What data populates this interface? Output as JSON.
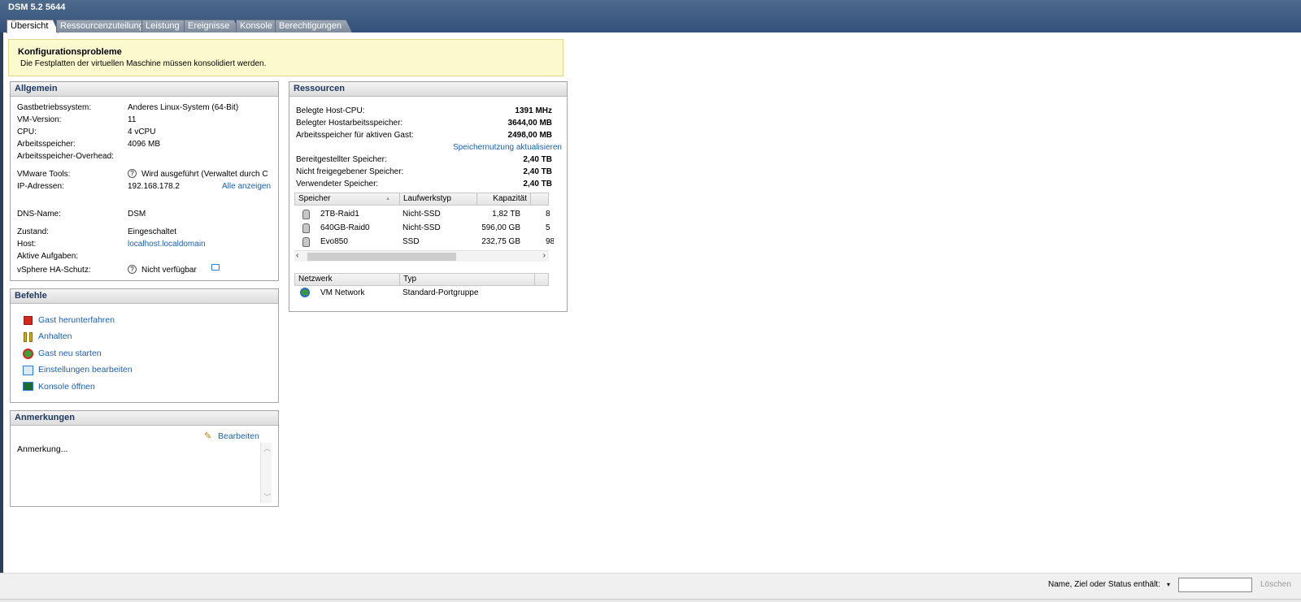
{
  "window": {
    "title": "DSM 5.2 5644"
  },
  "tabs": [
    {
      "label": "Übersicht"
    },
    {
      "label": "Ressourcenzuteilung"
    },
    {
      "label": "Leistung"
    },
    {
      "label": "Ereignisse"
    },
    {
      "label": "Konsole"
    },
    {
      "label": "Berechtigungen"
    }
  ],
  "alert": {
    "title": "Konfigurationsprobleme",
    "text": "Die Festplatten der virtuellen Maschine müssen konsolidiert werden."
  },
  "general": {
    "title": "Allgemein",
    "rows": [
      {
        "label": "Gastbetriebssystem:",
        "value": "Anderes Linux-System (64-Bit)"
      },
      {
        "label": "VM-Version:",
        "value": "11"
      },
      {
        "label": "CPU:",
        "value": "4 vCPU"
      },
      {
        "label": "Arbeitsspeicher:",
        "value": "4096 MB"
      },
      {
        "label": "Arbeitsspeicher-Overhead:",
        "value": ""
      },
      {
        "label": "VMware Tools:",
        "value": "Wird ausgeführt (Verwaltet durch C"
      },
      {
        "label": "IP-Adressen:",
        "value": "192.168.178.2"
      },
      {
        "label": "DNS-Name:",
        "value": "DSM"
      },
      {
        "label": "Zustand:",
        "value": "Eingeschaltet"
      },
      {
        "label": "Host:",
        "value": "localhost.localdomain"
      },
      {
        "label": "Aktive Aufgaben:",
        "value": ""
      },
      {
        "label": "vSphere HA-Schutz:",
        "value": "Nicht verfügbar"
      }
    ],
    "show_all_link": "Alle anzeigen"
  },
  "commands": {
    "title": "Befehle",
    "items": [
      {
        "label": "Gast herunterfahren",
        "icon": "stop-icon",
        "color": "#d9261c"
      },
      {
        "label": "Anhalten",
        "icon": "pause-icon",
        "color": "#e0a800"
      },
      {
        "label": "Gast neu starten",
        "icon": "restart-icon",
        "color": "#d9261c"
      },
      {
        "label": "Einstellungen bearbeiten",
        "icon": "edit-settings-icon",
        "color": "#2a7fd6"
      },
      {
        "label": "Konsole öffnen",
        "icon": "console-icon",
        "color": "#2a7fd6"
      }
    ]
  },
  "notes": {
    "title": "Anmerkungen",
    "edit_label": "Bearbeiten",
    "text": "Anmerkung..."
  },
  "resources": {
    "title": "Ressourcen",
    "rows1": [
      {
        "label": "Belegte Host-CPU:",
        "value": "1391 MHz"
      },
      {
        "label": "Belegter Hostarbeitsspeicher:",
        "value": "3644,00 MB"
      },
      {
        "label": "Arbeitsspeicher für aktiven Gast:",
        "value": "2498,00 MB"
      }
    ],
    "refresh_link": "Speichernutzung aktualisieren",
    "rows2": [
      {
        "label": "Bereitgestellter Speicher:",
        "value": "2,40 TB"
      },
      {
        "label": "Nicht freigegebener Speicher:",
        "value": "2,40 TB"
      },
      {
        "label": "Verwendeter Speicher:",
        "value": "2,40 TB"
      }
    ],
    "storage_headers": [
      "Speicher",
      "Laufwerkstyp",
      "Kapazität"
    ],
    "storage": [
      {
        "name": "2TB-Raid1",
        "type": "Nicht-SSD",
        "capacity": "1,82 TB",
        "extra": "8"
      },
      {
        "name": "640GB-Raid0",
        "type": "Nicht-SSD",
        "capacity": "596,00 GB",
        "extra": "5"
      },
      {
        "name": "Evo850",
        "type": "SSD",
        "capacity": "232,75 GB",
        "extra": "98"
      }
    ],
    "network_headers": [
      "Netzwerk",
      "Typ"
    ],
    "network": [
      {
        "name": "VM Network",
        "type": "Standard-Portgruppe"
      }
    ]
  },
  "footer": {
    "filter_label": "Name, Ziel oder Status enthält:",
    "filter_value": "",
    "clear_label": "Löschen"
  }
}
